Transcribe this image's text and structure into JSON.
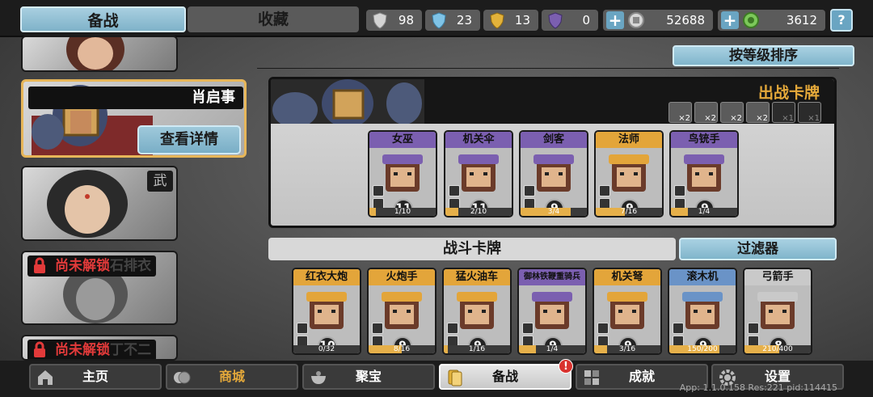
{
  "top_tabs": {
    "prep": "备战",
    "favorites": "收藏"
  },
  "resources": [
    {
      "name": "silver-shield",
      "value": "98",
      "color": "#c9c9c9"
    },
    {
      "name": "blue-crystal",
      "value": "23",
      "color": "#7fc3e6"
    },
    {
      "name": "gold-shield",
      "value": "13",
      "color": "#e3b23a"
    },
    {
      "name": "purple-token",
      "value": "0",
      "color": "#7b5fb0"
    },
    {
      "name": "coin",
      "value": "52688",
      "color": "#cfcfcf"
    },
    {
      "name": "jade",
      "value": "3612",
      "color": "#7cc85a"
    }
  ],
  "help_glyph": "?",
  "heroes": [
    {
      "name": "肖启事",
      "detail": "查看详情",
      "selected": true
    },
    {
      "tag": "武"
    },
    {
      "lock_text": "尚未解锁",
      "suffix": "石排衣"
    },
    {
      "lock_text": "尚未解锁",
      "suffix": "丁不二"
    }
  ],
  "sort_label": "按等级排序",
  "deck": {
    "title": "出战卡牌",
    "slots": [
      "×2",
      "×2",
      "×2",
      "×2",
      "×1",
      "×1"
    ],
    "cards": [
      {
        "name": "女巫",
        "cost": "11",
        "progress": "1/10",
        "fill": 0.1,
        "header": "#7b5fb0"
      },
      {
        "name": "机关伞",
        "cost": "11",
        "progress": "2/10",
        "fill": 0.2,
        "header": "#7b5fb0"
      },
      {
        "name": "剑客",
        "cost": "9",
        "progress": "3/4",
        "fill": 0.75,
        "header": "#7b5fb0"
      },
      {
        "name": "法师",
        "cost": "9",
        "progress": "7/16",
        "fill": 0.44,
        "header": "#e3a53a"
      },
      {
        "name": "鸟铳手",
        "cost": "9",
        "progress": "1/4",
        "fill": 0.25,
        "header": "#7b5fb0"
      }
    ]
  },
  "battle_cards_title": "战斗卡牌",
  "filter_label": "过滤器",
  "battle_cards": [
    {
      "name": "红衣大炮",
      "cost": "10",
      "progress": "0/32",
      "fill": 0.0,
      "header": "#e3a53a"
    },
    {
      "name": "火炮手",
      "cost": "9",
      "progress": "8/16",
      "fill": 0.5,
      "header": "#e3a53a"
    },
    {
      "name": "猛火油车",
      "cost": "9",
      "progress": "1/16",
      "fill": 0.06,
      "header": "#e3a53a"
    },
    {
      "name": "御林铁鞭重骑兵",
      "cost": "9",
      "progress": "1/4",
      "fill": 0.25,
      "header": "#7b5fb0"
    },
    {
      "name": "机关弩",
      "cost": "9",
      "progress": "3/16",
      "fill": 0.19,
      "header": "#e3a53a"
    },
    {
      "name": "滚木机",
      "cost": "9",
      "progress": "150/200",
      "fill": 0.75,
      "header": "#6a93c7"
    },
    {
      "name": "弓箭手",
      "cost": "8",
      "progress": "210/400",
      "fill": 0.52,
      "header": "#c9c9c9"
    }
  ],
  "nav": [
    {
      "label": "主页"
    },
    {
      "label": "商城"
    },
    {
      "label": "聚宝"
    },
    {
      "label": "备战"
    },
    {
      "label": "成就"
    },
    {
      "label": "设置"
    }
  ],
  "nav_badge": "!",
  "app_info": "App: 1.1.0.158 Res:221 pid:114415"
}
